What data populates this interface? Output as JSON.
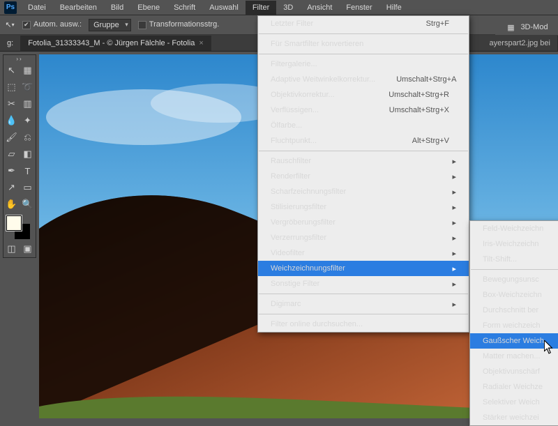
{
  "menubar": {
    "items": [
      "Datei",
      "Bearbeiten",
      "Bild",
      "Ebene",
      "Schrift",
      "Auswahl",
      "Filter",
      "3D",
      "Ansicht",
      "Fenster",
      "Hilfe"
    ]
  },
  "optbar": {
    "auto_select": "Autom. ausw.:",
    "group": "Gruppe",
    "transform": "Transformationsstrg."
  },
  "right": {
    "mode": "3D-Mod"
  },
  "tabs": {
    "left": "Fotolia_31333343_M - © Jürgen Fälchle - Fotolia",
    "left_suffix": "g:",
    "right": "ayerspart2.jpg bei"
  },
  "tools": {
    "move": "↖",
    "artboard": "▦",
    "marquee": "⬚",
    "lasso": "➰",
    "crop": "✂",
    "slice": "▥",
    "eyedrop": "💧",
    "heal": "✦",
    "brush": "🖌",
    "stamp": "⎌",
    "eraser": "▱",
    "grad": "◧",
    "pen": "✒",
    "type": "T",
    "path": "↗",
    "shape": "▭",
    "hand": "✋",
    "zoom": "🔍",
    "qmask": "◫",
    "screen": "▣"
  },
  "filter_menu": {
    "last": {
      "label": "Letzter Filter",
      "shortcut": "Strg+F"
    },
    "smart": {
      "label": "Für Smartfilter konvertieren"
    },
    "gallery": {
      "label": "Filtergalerie..."
    },
    "adaptive": {
      "label": "Adaptive Weitwinkelkorrektur...",
      "shortcut": "Umschalt+Strg+A"
    },
    "lens": {
      "label": "Objektivkorrektur...",
      "shortcut": "Umschalt+Strg+R"
    },
    "liquify": {
      "label": "Verflüssigen...",
      "shortcut": "Umschalt+Strg+X"
    },
    "oil": {
      "label": "Ölfarbe..."
    },
    "vanish": {
      "label": "Fluchtpunkt...",
      "shortcut": "Alt+Strg+V"
    },
    "noise": {
      "label": "Rauschfilter"
    },
    "render": {
      "label": "Renderfilter"
    },
    "sharpen": {
      "label": "Scharfzeichnungsfilter"
    },
    "stylize": {
      "label": "Stilisierungsfilter"
    },
    "pixelate": {
      "label": "Vergröberungsfilter"
    },
    "distort": {
      "label": "Verzerrungsfilter"
    },
    "video": {
      "label": "Videofilter"
    },
    "blur": {
      "label": "Weichzeichnungsfilter"
    },
    "other": {
      "label": "Sonstige Filter"
    },
    "digimarc": {
      "label": "Digimarc"
    },
    "browse": {
      "label": "Filter online durchsuchen..."
    }
  },
  "blur_sub": {
    "field": "Feld-Weichzeichn",
    "iris": "Iris-Weichzeichn",
    "tilt": "Tilt-Shift...",
    "motion": "Bewegungsunsc",
    "box": "Box-Weichzeichn",
    "avg": "Durchschnitt ber",
    "shape": "Form weichzeich",
    "gauss": "Gaußscher Weich",
    "matte": "Matter machen...",
    "lens": "Objektivunschärf",
    "radial": "Radialer Weichze",
    "selective": "Selektiver Weich",
    "smart": "Stärker weichzei"
  }
}
